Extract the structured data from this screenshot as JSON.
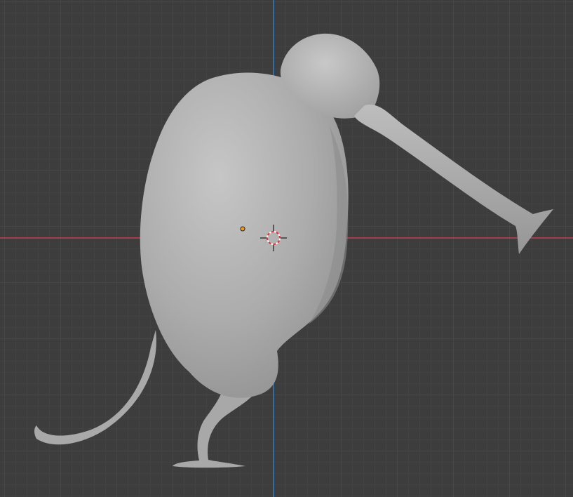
{
  "viewport": {
    "background_color": "#3d3d3d",
    "grid_minor_color": "#474747",
    "grid_major_color": "#525252",
    "x_axis_color": "#c63c4f",
    "y_axis_color": "#2e7ec9"
  },
  "scene": {
    "object": "kiwi-bird-mesh",
    "object_color": "#b5b5b5",
    "origin_point_color": "#f0a020",
    "cursor_icon": "3d-cursor-icon"
  }
}
